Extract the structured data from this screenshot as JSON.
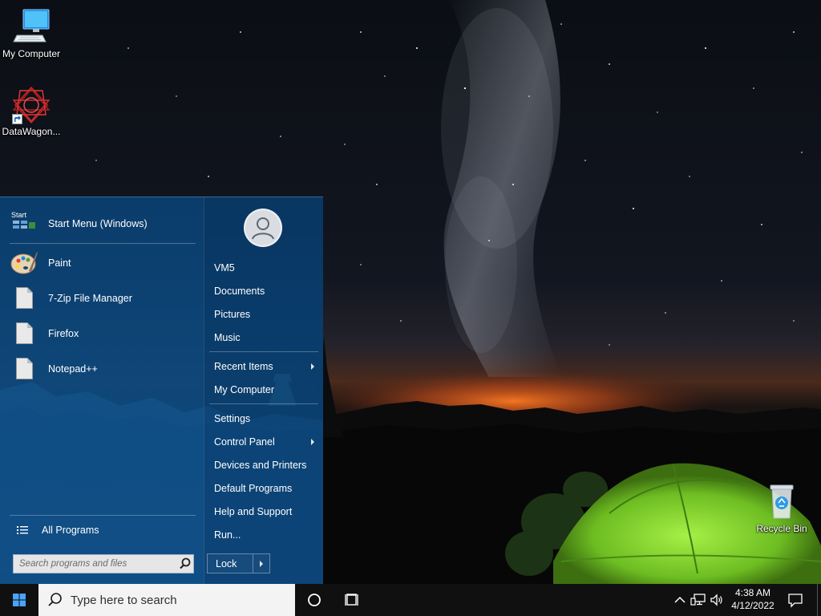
{
  "desktop": {
    "icons": [
      {
        "label": "My Computer",
        "icon": "monitor-icon"
      },
      {
        "label": "DataWagon...",
        "icon": "datawagon-logo-icon"
      },
      {
        "label": "Recycle Bin",
        "icon": "recycle-bin-icon"
      }
    ]
  },
  "start_menu": {
    "header_item": {
      "label": "Start Menu (Windows)",
      "icon": "start-menu-app-icon",
      "icon_text": "Start"
    },
    "programs": [
      {
        "label": "Paint",
        "icon": "paint-palette-icon"
      },
      {
        "label": "7-Zip File Manager",
        "icon": "document-icon"
      },
      {
        "label": "Firefox",
        "icon": "document-icon"
      },
      {
        "label": "Notepad++",
        "icon": "document-icon"
      }
    ],
    "all_programs": {
      "label": "All Programs",
      "icon": "list-icon"
    },
    "search": {
      "placeholder": "Search programs and files",
      "icon": "search-icon"
    },
    "user": {
      "icon": "user-avatar-icon"
    },
    "right_items": [
      {
        "label": "VM5"
      },
      {
        "label": "Documents"
      },
      {
        "label": "Pictures"
      },
      {
        "label": "Music"
      },
      {
        "label": "Recent Items",
        "has_submenu": true
      },
      {
        "label": "My Computer"
      },
      {
        "label": "Settings"
      },
      {
        "label": "Control Panel",
        "has_submenu": true
      },
      {
        "label": "Devices and Printers"
      },
      {
        "label": "Default Programs"
      },
      {
        "label": "Help and Support"
      },
      {
        "label": "Run..."
      }
    ],
    "lock": {
      "label": "Lock"
    }
  },
  "taskbar": {
    "start_icon": "windows-logo-icon",
    "search_placeholder": "Type here to search",
    "cortana_icon": "cortana-circle-icon",
    "task_view_icon": "task-view-icon",
    "tray": [
      "chevron-up-icon",
      "network-icon",
      "volume-icon"
    ],
    "clock": {
      "time": "4:38 AM",
      "date": "4/12/2022"
    },
    "notification_icon": "notification-icon"
  },
  "colors": {
    "start_menu_bg": "#0c4a80",
    "taskbar_bg": "#101010",
    "search_bg": "#f3f3f3",
    "tent_green": "#8fe034",
    "horizon_orange": "#e2621c"
  }
}
